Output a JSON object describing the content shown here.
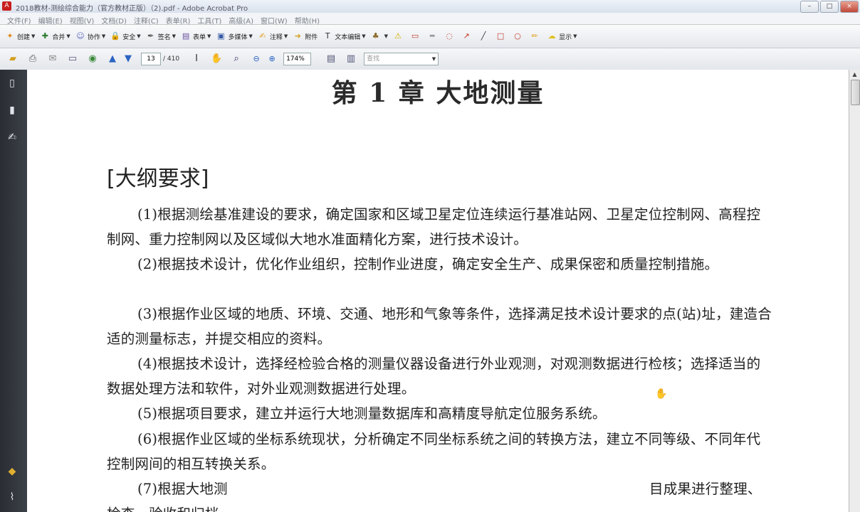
{
  "window": {
    "app_icon": "acrobat-pdf-icon",
    "title": "2018教材-测绘综合能力（官方教材正版）（2).pdf - Adobe Acrobat Pro",
    "controls": [
      "–",
      "□",
      "×"
    ]
  },
  "menu": [
    "文件(F)",
    "编辑(E)",
    "视图(V)",
    "文档(D)",
    "注释(C)",
    "表单(R)",
    "工具(T)",
    "高级(A)",
    "窗口(W)",
    "帮助(H)"
  ],
  "toolbar1": [
    {
      "label": "创建",
      "icon": "create-icon",
      "dropdown": true
    },
    {
      "label": "合并",
      "icon": "merge-icon",
      "dropdown": true
    },
    {
      "label": "协作",
      "icon": "collaborate-icon",
      "dropdown": true
    },
    {
      "label": "安全",
      "icon": "lock-icon",
      "dropdown": true
    },
    {
      "label": "签名",
      "icon": "pen-icon",
      "dropdown": true
    },
    {
      "label": "表单",
      "icon": "form-icon",
      "dropdown": true
    },
    {
      "label": "多媒体",
      "icon": "multimedia-icon",
      "dropdown": true
    },
    {
      "label": "注释",
      "icon": "comment-icon",
      "dropdown": true
    },
    {
      "label": "附件",
      "icon": "attach-icon",
      "dropdown": false
    },
    {
      "label": "文本编辑",
      "icon": "text-edit-icon",
      "dropdown": true
    },
    {
      "label": "",
      "icon": "stamp-icon",
      "dropdown": true
    },
    {
      "label": "",
      "icon": "warning-icon",
      "dropdown": false
    },
    {
      "label": "",
      "icon": "highlight-icon",
      "dropdown": false
    },
    {
      "label": "",
      "icon": "strikethrough-icon",
      "dropdown": false
    },
    {
      "label": "",
      "icon": "cloud-icon",
      "dropdown": false
    },
    {
      "label": "",
      "icon": "arrow-tool-icon",
      "dropdown": false
    },
    {
      "label": "",
      "icon": "line-tool-icon",
      "dropdown": false
    },
    {
      "label": "",
      "icon": "rectangle-tool-icon",
      "dropdown": false
    },
    {
      "label": "",
      "icon": "oval-tool-icon",
      "dropdown": false
    },
    {
      "label": "",
      "icon": "pencil-icon",
      "dropdown": false
    },
    {
      "label": "显示",
      "icon": "show-comments-icon",
      "dropdown": true
    }
  ],
  "toolbar2": {
    "current_page": "13",
    "total_pages": "/ 410",
    "zoom": "174%",
    "search_placeholder": "查找"
  },
  "document": {
    "chapter_title": "第 1 章    大地测量",
    "section_title": "[大纲要求]",
    "paragraphs": [
      "(1)根据测绘基准建设的要求，确定国家和区域卫星定位连续运行基准站网、卫星定位控制网、高程控制网、重力控制网以及区域似大地水准面精化方案，进行技术设计。",
      "(2)根据技术设计，优化作业组织，控制作业进度，确定安全生产、成果保密和质量控制措施。",
      "(3)根据作业区域的地质、环境、交通、地形和气象等条件，选择满足技术设计要求的点(站)址，建造合适的测量标志，并提交相应的资料。",
      "(4)根据技术设计，选择经检验合格的测量仪器设备进行外业观测，对观测数据进行检核；选择适当的数据处理方法和软件，对外业观测数据进行处理。",
      "(5)根据项目要求，建立并运行大地测量数据库和高精度导航定位服务系统。",
      "(6)根据作业区域的坐标系统现状，分析确定不同坐标系统之间的转换方法，建立不同等级、不同年代控制网间的相互转换关系。"
    ],
    "para7_start": "(7)根据大地测",
    "para7_end": "目成果进行整理、",
    "para7_line2": "检查、验收和归档。"
  }
}
